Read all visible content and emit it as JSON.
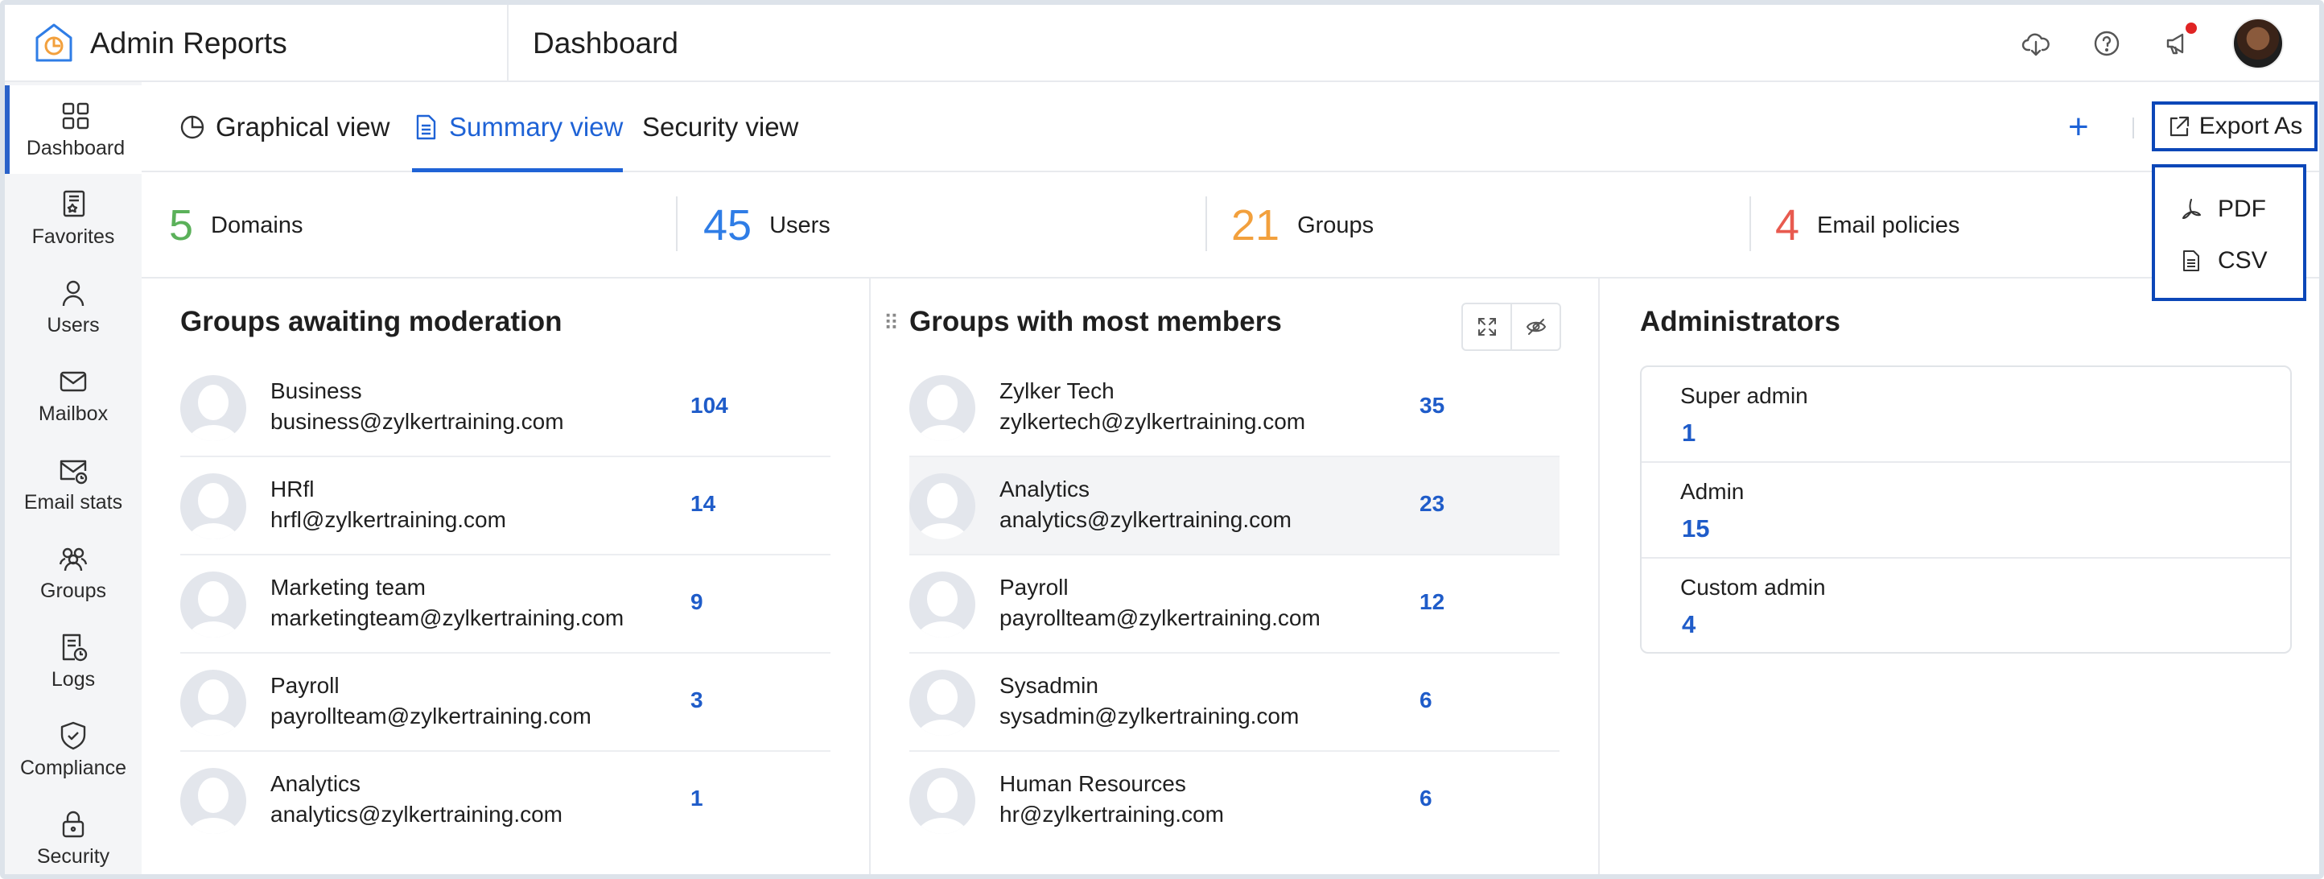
{
  "app": {
    "title": "Admin Reports",
    "page_title": "Dashboard"
  },
  "header_icons": [
    "cloud-download-icon",
    "help-icon",
    "announcement-icon",
    "avatar"
  ],
  "sidebar": {
    "items": [
      {
        "label": "Dashboard",
        "icon": "grid-icon",
        "active": true
      },
      {
        "label": "Favorites",
        "icon": "favorites-icon"
      },
      {
        "label": "Users",
        "icon": "user-icon"
      },
      {
        "label": "Mailbox",
        "icon": "mail-icon"
      },
      {
        "label": "Email stats",
        "icon": "email-stats-icon"
      },
      {
        "label": "Groups",
        "icon": "groups-icon"
      },
      {
        "label": "Logs",
        "icon": "logs-icon"
      },
      {
        "label": "Compliance",
        "icon": "shield-icon"
      },
      {
        "label": "Security",
        "icon": "lock-icon"
      }
    ]
  },
  "tabs": [
    {
      "label": "Graphical view",
      "icon": "pie-icon"
    },
    {
      "label": "Summary view",
      "icon": "document-icon",
      "active": true
    },
    {
      "label": "Security view"
    }
  ],
  "toolbar": {
    "plus": "+",
    "export_label": "Export As"
  },
  "export_menu": [
    {
      "label": "PDF",
      "icon": "pdf-icon"
    },
    {
      "label": "CSV",
      "icon": "csv-icon"
    }
  ],
  "stats": [
    {
      "value": "5",
      "label": "Domains",
      "color": "#5bb15a"
    },
    {
      "value": "45",
      "label": "Users",
      "color": "#2f7de6"
    },
    {
      "value": "21",
      "label": "Groups",
      "color": "#f2a03d"
    },
    {
      "value": "4",
      "label": "Email policies",
      "color": "#e85a4f"
    }
  ],
  "moderation": {
    "title": "Groups awaiting moderation",
    "rows": [
      {
        "name": "Business",
        "email": "business@zylkertraining.com",
        "count": "104"
      },
      {
        "name": "HRfl",
        "email": "hrfl@zylkertraining.com",
        "count": "14"
      },
      {
        "name": "Marketing team",
        "email": "marketingteam@zylkertraining.com",
        "count": "9"
      },
      {
        "name": "Payroll",
        "email": "payrollteam@zylkertraining.com",
        "count": "3"
      },
      {
        "name": "Analytics",
        "email": "analytics@zylkertraining.com",
        "count": "1"
      }
    ]
  },
  "members": {
    "title": "Groups with most members",
    "rows": [
      {
        "name": "Zylker Tech",
        "email": "zylkertech@zylkertraining.com",
        "count": "35"
      },
      {
        "name": "Analytics",
        "email": "analytics@zylkertraining.com",
        "count": "23"
      },
      {
        "name": "Payroll",
        "email": "payrollteam@zylkertraining.com",
        "count": "12"
      },
      {
        "name": "Sysadmin",
        "email": "sysadmin@zylkertraining.com",
        "count": "6"
      },
      {
        "name": "Human Resources",
        "email": "hr@zylkertraining.com",
        "count": "6"
      }
    ]
  },
  "administrators": {
    "title": "Administrators",
    "rows": [
      {
        "label": "Super admin",
        "value": "1"
      },
      {
        "label": "Admin",
        "value": "15"
      },
      {
        "label": "Custom admin",
        "value": "4"
      }
    ]
  }
}
